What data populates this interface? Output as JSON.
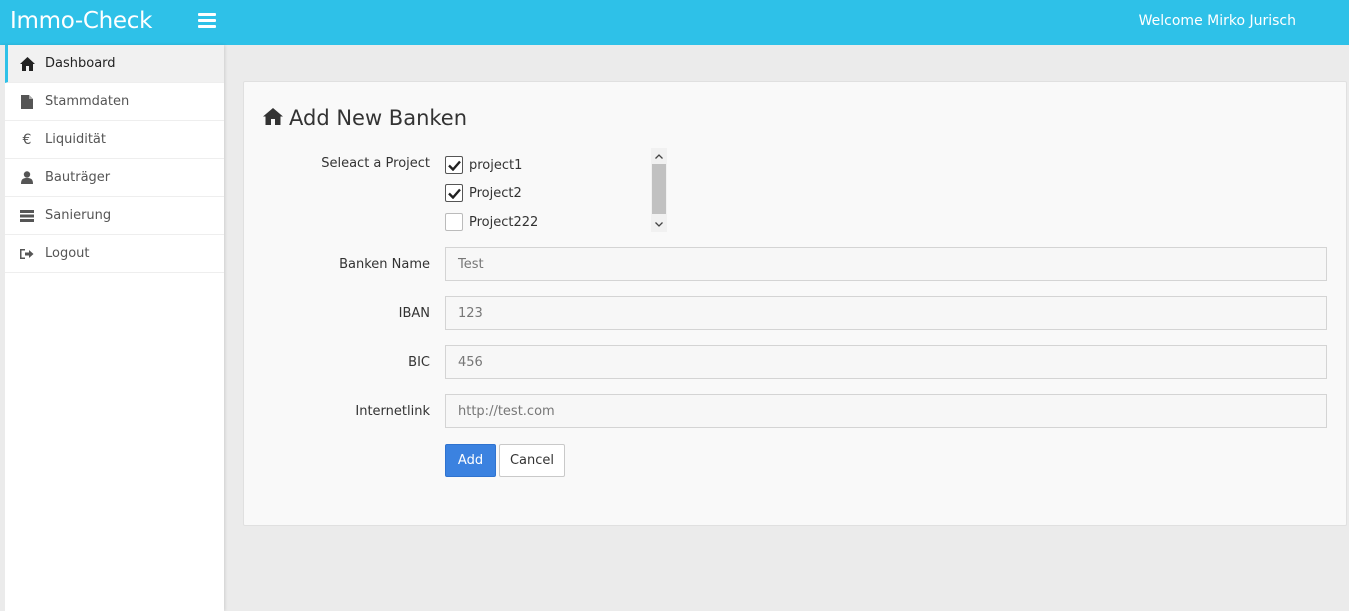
{
  "app": {
    "brand": "Immo-Check",
    "welcome": "Welcome Mirko Jurisch"
  },
  "sidebar": {
    "items": [
      {
        "label": "Dashboard",
        "icon": "home-icon",
        "active": true
      },
      {
        "label": "Stammdaten",
        "icon": "file-icon",
        "active": false
      },
      {
        "label": "Liquidität",
        "icon": "euro-icon",
        "active": false
      },
      {
        "label": "Bauträger",
        "icon": "user-icon",
        "active": false
      },
      {
        "label": "Sanierung",
        "icon": "server-icon",
        "active": false
      },
      {
        "label": "Logout",
        "icon": "logout-icon",
        "active": false
      }
    ]
  },
  "form": {
    "title": "Add New Banken",
    "project_label": "Seleact a Project",
    "projects": [
      {
        "name": "project1",
        "checked": true
      },
      {
        "name": "Project2",
        "checked": true
      },
      {
        "name": "Project222",
        "checked": false
      }
    ],
    "bank_name_label": "Banken Name",
    "bank_name_value": "Test",
    "iban_label": "IBAN",
    "iban_value": "123",
    "bic_label": "BIC",
    "bic_value": "456",
    "internetlink_label": "Internetlink",
    "internetlink_value": "http://test.com",
    "add_label": "Add",
    "cancel_label": "Cancel"
  },
  "colors": {
    "topbar": "#2ec1e8",
    "primary_button": "#3b82e0"
  }
}
